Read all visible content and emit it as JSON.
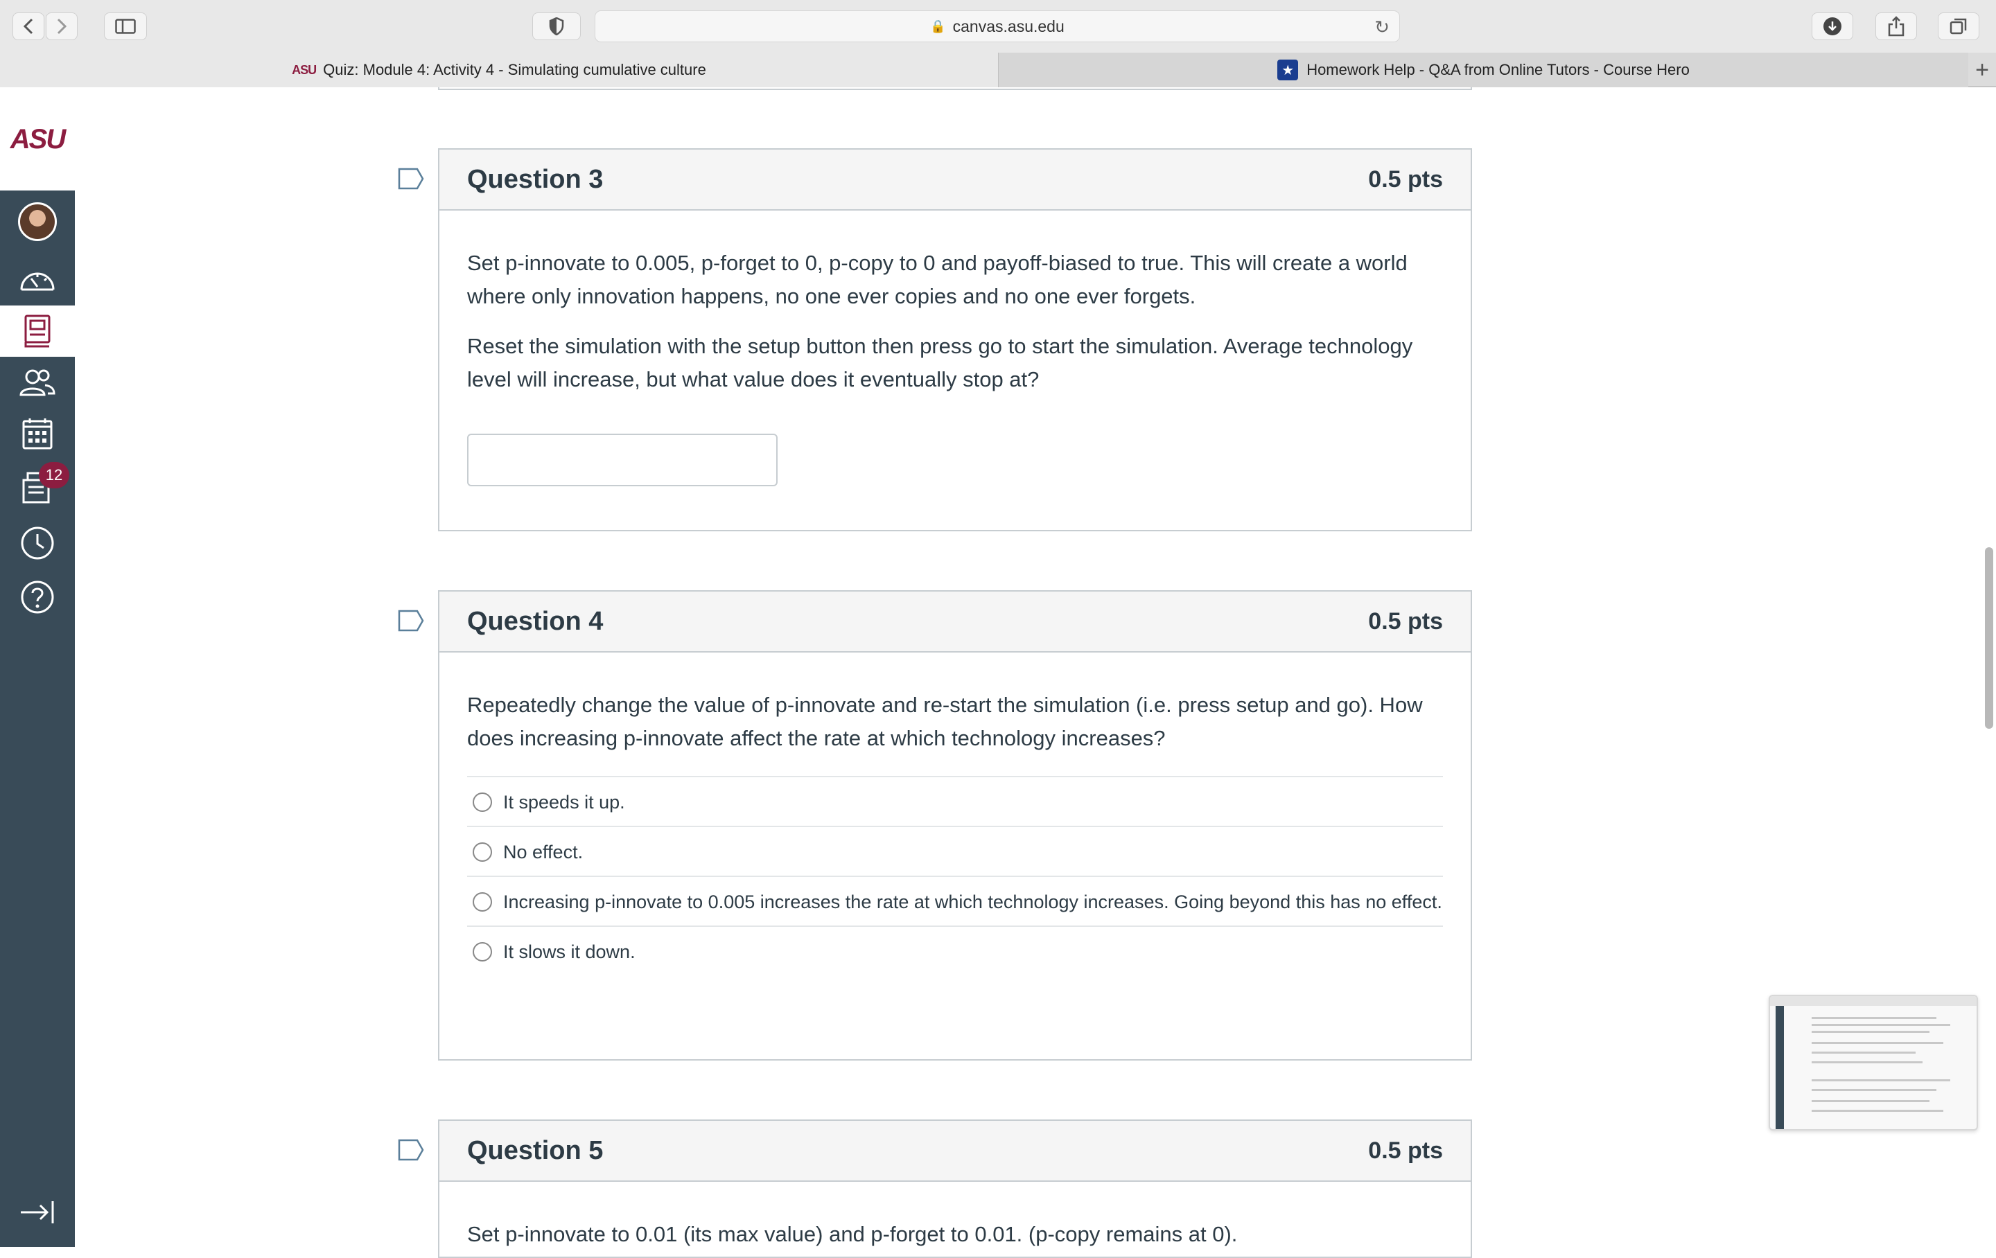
{
  "browser": {
    "url": "canvas.asu.edu",
    "tabs": [
      {
        "favicon": "ASU",
        "title": "Quiz: Module 4: Activity 4 - Simulating cumulative culture"
      },
      {
        "favicon": "course-hero-star",
        "title": "Homework Help - Q&A from Online Tutors - Course Hero"
      }
    ],
    "new_tab": "+"
  },
  "global_nav": {
    "logo": "ASU",
    "items": [
      "account",
      "dashboard",
      "courses",
      "groups",
      "calendar",
      "inbox",
      "history",
      "help"
    ],
    "inbox_badge": "12"
  },
  "questions": [
    {
      "title": "Question 3",
      "points": "0.5 pts",
      "paragraphs": [
        "Set p-innovate to 0.005, p-forget to 0, p-copy to 0 and payoff-biased to true. This will create a world where only innovation happens, no one ever copies and no one ever forgets.",
        "Reset the simulation with the setup button then press go to start the simulation. Average technology level will increase, but what value does it eventually stop at?"
      ],
      "answer_value": ""
    },
    {
      "title": "Question 4",
      "points": "0.5 pts",
      "paragraphs": [
        "Repeatedly change the value of p-innovate and re-start the simulation (i.e. press setup and go). How does increasing p-innovate affect the rate at which technology increases?"
      ],
      "options": [
        "It speeds it up.",
        "No effect.",
        "Increasing p-innovate to 0.005 increases the rate at which technology increases. Going beyond this has no effect.",
        "It slows it down."
      ]
    },
    {
      "title": "Question 5",
      "points": "0.5 pts",
      "paragraphs": [
        "Set p-innovate to 0.01 (its max value) and p-forget to 0.01. (p-copy remains at 0)."
      ]
    }
  ],
  "colors": {
    "asu_maroon": "#8c1d40",
    "nav_bg": "#394b58",
    "text": "#2d3b45",
    "border": "#c7cdd1"
  }
}
